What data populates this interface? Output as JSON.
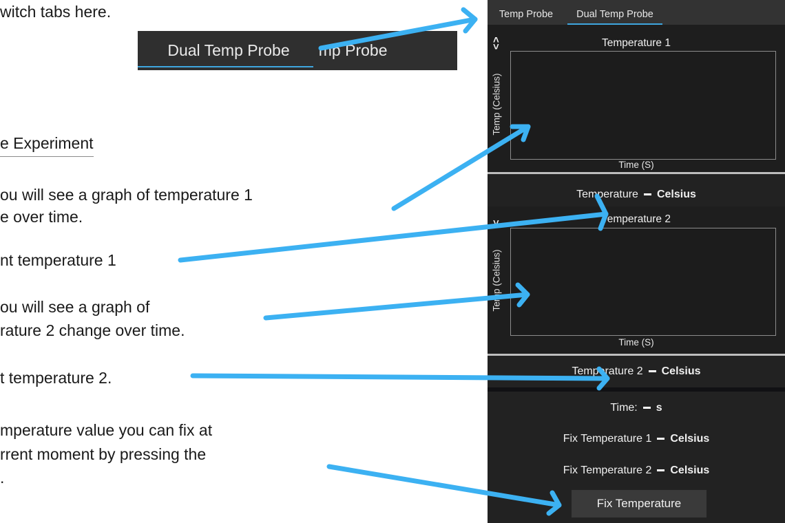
{
  "instructions": {
    "line_tabs": "witch tabs here.",
    "section_title": "e Experiment",
    "line_graph1_a": "ou will see a graph of temperature 1",
    "line_graph1_b": "e over time.",
    "line_temp1": "nt temperature 1",
    "line_graph2_a": "ou will see a graph of",
    "line_graph2_b": "rature 2 change over time.",
    "line_temp2": "t temperature 2.",
    "line_fix_a": "mperature value you can fix at",
    "line_fix_b": "rrent moment by pressing the",
    "line_fix_c": "."
  },
  "zoom_tabs": {
    "tab1": "Temp Probe",
    "tab2": "Dual Temp Probe"
  },
  "app": {
    "tabs": [
      "Temp Probe",
      "Dual Temp Probe"
    ],
    "active_tab": "Dual Temp Probe",
    "graph1": {
      "title": "Temperature 1",
      "ylabel": "Temp (Celsius)",
      "xlabel": "Time (S)"
    },
    "readout1": {
      "label": "Temperature",
      "unit": "Celsius"
    },
    "graph2": {
      "title": "Temperature 2",
      "ylabel": "Temp (Celsius)",
      "xlabel": "Time (S)"
    },
    "readout2": {
      "label": "Temperature 2",
      "unit": "Celsius"
    },
    "time": {
      "label": "Time:",
      "unit": "s"
    },
    "fix1": {
      "label": "Fix Temperature 1",
      "unit": "Celsius"
    },
    "fix2": {
      "label": "Fix Temperature 2",
      "unit": "Celsius"
    },
    "fix_button": "Fix Temperature"
  },
  "colors": {
    "arrow": "#3cb1f2",
    "accent": "#3fa7e0",
    "panel_bg": "#1e1e1e"
  }
}
